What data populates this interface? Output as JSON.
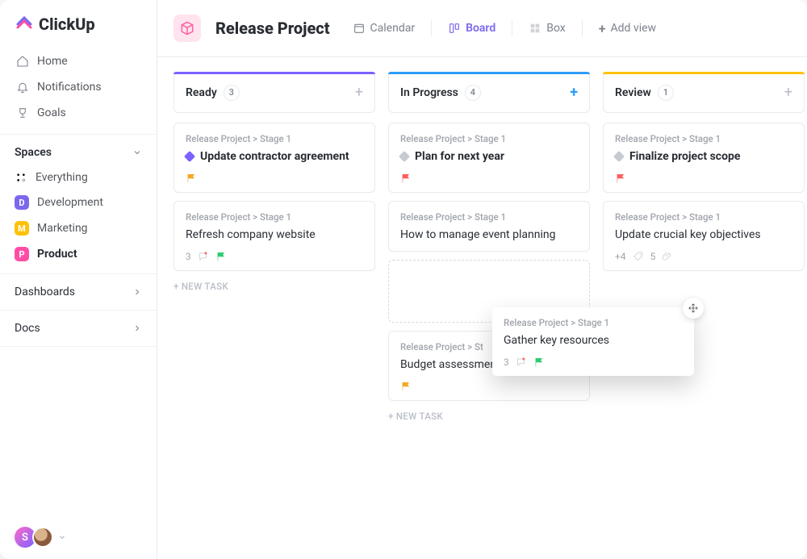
{
  "brand": "ClickUp",
  "sidebar": {
    "nav": [
      {
        "label": "Home",
        "icon": "home"
      },
      {
        "label": "Notifications",
        "icon": "bell"
      },
      {
        "label": "Goals",
        "icon": "trophy"
      }
    ],
    "spaces_header": "Spaces",
    "everything_label": "Everything",
    "spaces": [
      {
        "label": "Development",
        "letter": "D",
        "color": "#7b68ee"
      },
      {
        "label": "Marketing",
        "letter": "M",
        "color": "#ffc107"
      },
      {
        "label": "Product",
        "letter": "P",
        "color": "#ff4da6",
        "active": true
      }
    ],
    "bottom": [
      {
        "label": "Dashboards"
      },
      {
        "label": "Docs"
      }
    ],
    "avatar_letter": "S"
  },
  "header": {
    "project_title": "Release Project",
    "views": [
      {
        "label": "Calendar",
        "icon": "calendar"
      },
      {
        "label": "Board",
        "icon": "board",
        "active": true
      },
      {
        "label": "Box",
        "icon": "box"
      }
    ],
    "add_view_label": "Add view"
  },
  "board": {
    "columns": [
      {
        "name": "Ready",
        "count": "3",
        "bar_color": "#7b61ff",
        "cards": [
          {
            "crumb": "Release Project > Stage 1",
            "title": "Update contractor agreement",
            "bold": true,
            "diamond": "#7b61ff",
            "flag": "#f5a623"
          },
          {
            "crumb": "Release Project > Stage 1",
            "title": "Refresh company website",
            "comments": "3",
            "flag": "#2ecc71"
          }
        ],
        "new_task": "+ NEW TASK"
      },
      {
        "name": "In Progress",
        "count": "4",
        "bar_color": "#2e9df7",
        "plus_highlight": true,
        "cards": [
          {
            "crumb": "Release Project > Stage 1",
            "title": "Plan for next year",
            "bold": true,
            "diamond": "#c7cbd1",
            "flag": "#ff5c5c"
          },
          {
            "crumb": "Release Project > Stage 1",
            "title": "How to manage event planning"
          },
          {
            "placeholder": true
          },
          {
            "crumb": "Release Project > St",
            "title": "Budget assessment",
            "flag": "#f5a623"
          }
        ],
        "new_task": "+ NEW TASK"
      },
      {
        "name": "Review",
        "count": "1",
        "bar_color": "#ffc107",
        "cards": [
          {
            "crumb": "Release Project > Stage 1",
            "title": "Finalize project scope",
            "bold": true,
            "diamond": "#c7cbd1",
            "flag": "#ff5c5c"
          },
          {
            "crumb": "Release Project > Stage 1",
            "title": "Update crucial key objectives",
            "tags": "+4",
            "attachments": "5"
          }
        ]
      }
    ],
    "drag_card": {
      "crumb": "Release Project > Stage 1",
      "title": "Gather key resources",
      "comments": "3",
      "flag": "#2ecc71"
    }
  }
}
